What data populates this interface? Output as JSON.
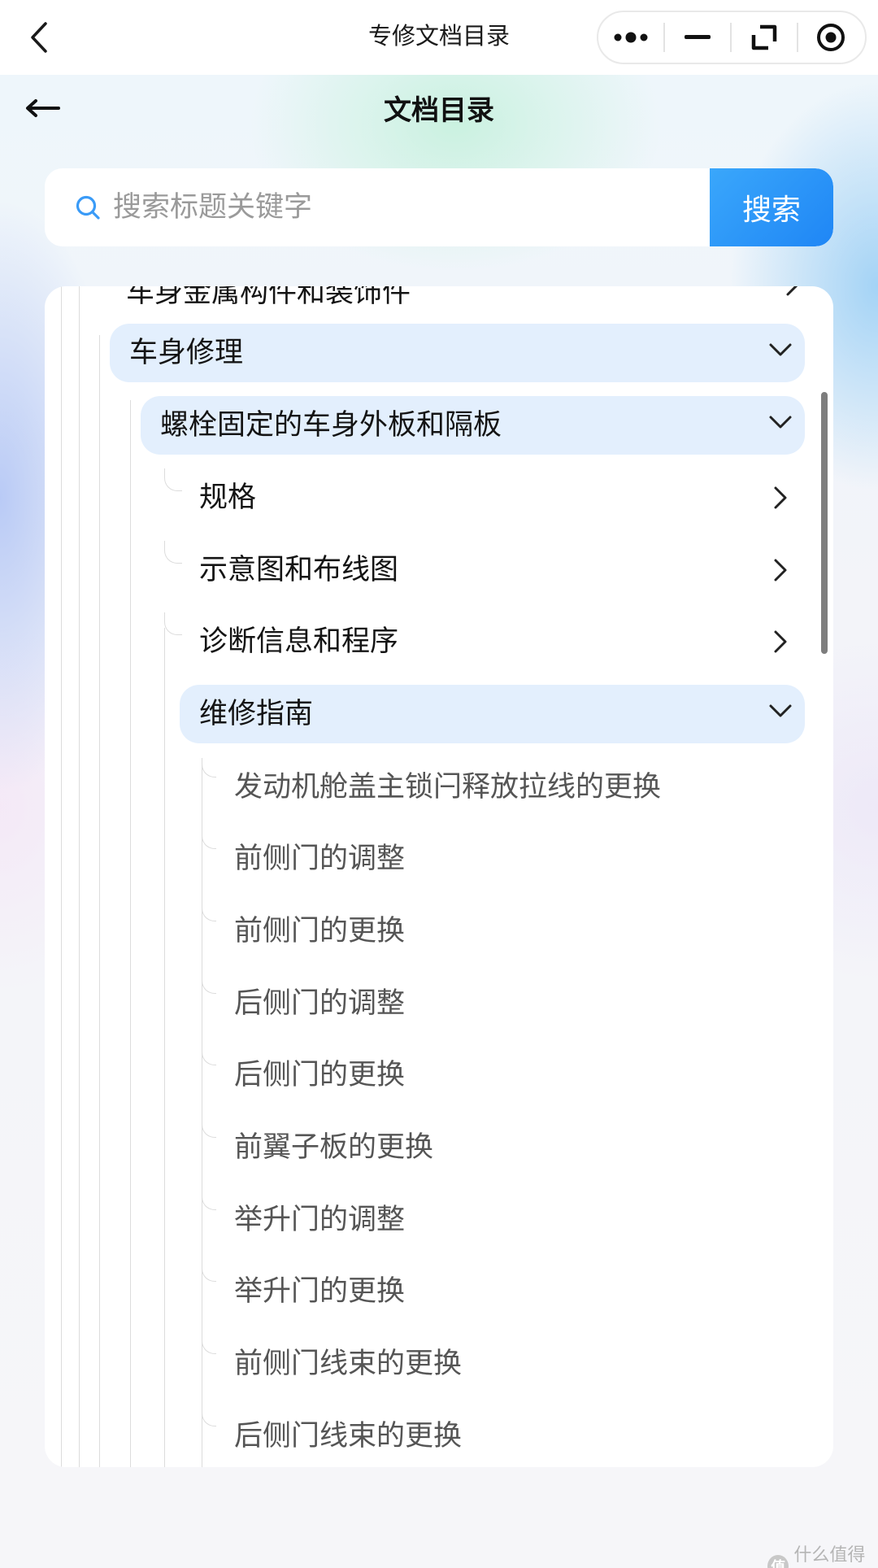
{
  "topbar": {
    "title": "专修文档目录"
  },
  "page": {
    "title": "文档目录"
  },
  "search": {
    "placeholder": "搜索标题关键字",
    "button_label": "搜索"
  },
  "tree": {
    "level1_partial": "车身金属构件和装饰件",
    "level1_expanded": "车身修理",
    "level2_expanded": "螺栓固定的车身外板和隔板",
    "level3_items": [
      "规格",
      "示意图和布线图",
      "诊断信息和程序"
    ],
    "level3_expanded": "维修指南",
    "level4_items": [
      "发动机舱盖主锁闩释放拉线的更换",
      "前侧门的调整",
      "前侧门的更换",
      "后侧门的调整",
      "后侧门的更换",
      "前翼子板的更换",
      "举升门的调整",
      "举升门的更换",
      "前侧门线束的更换",
      "后侧门线束的更换"
    ]
  },
  "watermark": {
    "badge": "值",
    "text": "什么值得买"
  },
  "colors": {
    "accent": "#1f86f5",
    "highlight": "#e3effd"
  },
  "icons": [
    "back-chevron-icon",
    "more-dots-icon",
    "minimize-icon",
    "restore-icon",
    "target-icon",
    "arrow-left-icon",
    "search-icon",
    "chevron-right-icon",
    "chevron-down-icon"
  ]
}
